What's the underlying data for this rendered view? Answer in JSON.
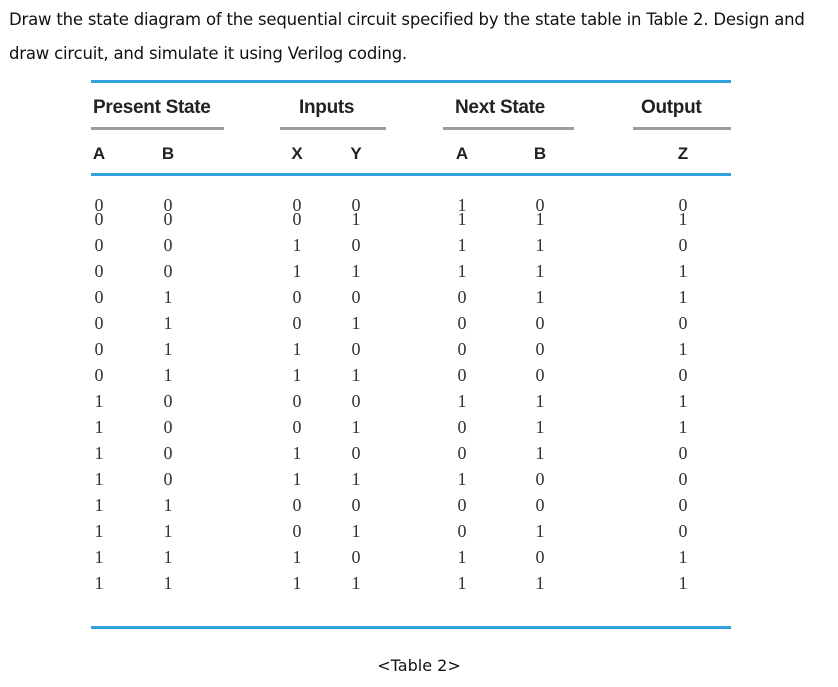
{
  "prompt": {
    "line1": "Draw the state diagram of the sequential circuit specified by the state table in Table 2. Design and",
    "line2": "draw circuit, and simulate it using Verilog coding."
  },
  "table": {
    "groups": {
      "present_state": "Present State",
      "inputs": "Inputs",
      "next_state": "Next State",
      "output": "Output"
    },
    "columns": [
      "A",
      "B",
      "X",
      "Y",
      "A",
      "B",
      "Z"
    ],
    "rows": [
      [
        "0",
        "0",
        "0",
        "0",
        "1",
        "0",
        "0"
      ],
      [
        "0",
        "0",
        "0",
        "1",
        "1",
        "1",
        "1"
      ],
      [
        "0",
        "0",
        "1",
        "0",
        "1",
        "1",
        "0"
      ],
      [
        "0",
        "0",
        "1",
        "1",
        "1",
        "1",
        "1"
      ],
      [
        "0",
        "1",
        "0",
        "0",
        "0",
        "1",
        "1"
      ],
      [
        "0",
        "1",
        "0",
        "1",
        "0",
        "0",
        "0"
      ],
      [
        "0",
        "1",
        "1",
        "0",
        "0",
        "0",
        "1"
      ],
      [
        "0",
        "1",
        "1",
        "1",
        "0",
        "0",
        "0"
      ],
      [
        "1",
        "0",
        "0",
        "0",
        "1",
        "1",
        "1"
      ],
      [
        "1",
        "0",
        "0",
        "1",
        "0",
        "1",
        "1"
      ],
      [
        "1",
        "0",
        "1",
        "0",
        "0",
        "1",
        "0"
      ],
      [
        "1",
        "0",
        "1",
        "1",
        "1",
        "0",
        "0"
      ],
      [
        "1",
        "1",
        "0",
        "0",
        "0",
        "0",
        "0"
      ],
      [
        "1",
        "1",
        "0",
        "1",
        "0",
        "1",
        "0"
      ],
      [
        "1",
        "1",
        "1",
        "0",
        "1",
        "0",
        "1"
      ],
      [
        "1",
        "1",
        "1",
        "1",
        "1",
        "1",
        "1"
      ]
    ],
    "caption": "<Table 2>"
  },
  "colors": {
    "rule_blue": "#2ea3dc",
    "rule_gray": "#9d9d9d"
  }
}
